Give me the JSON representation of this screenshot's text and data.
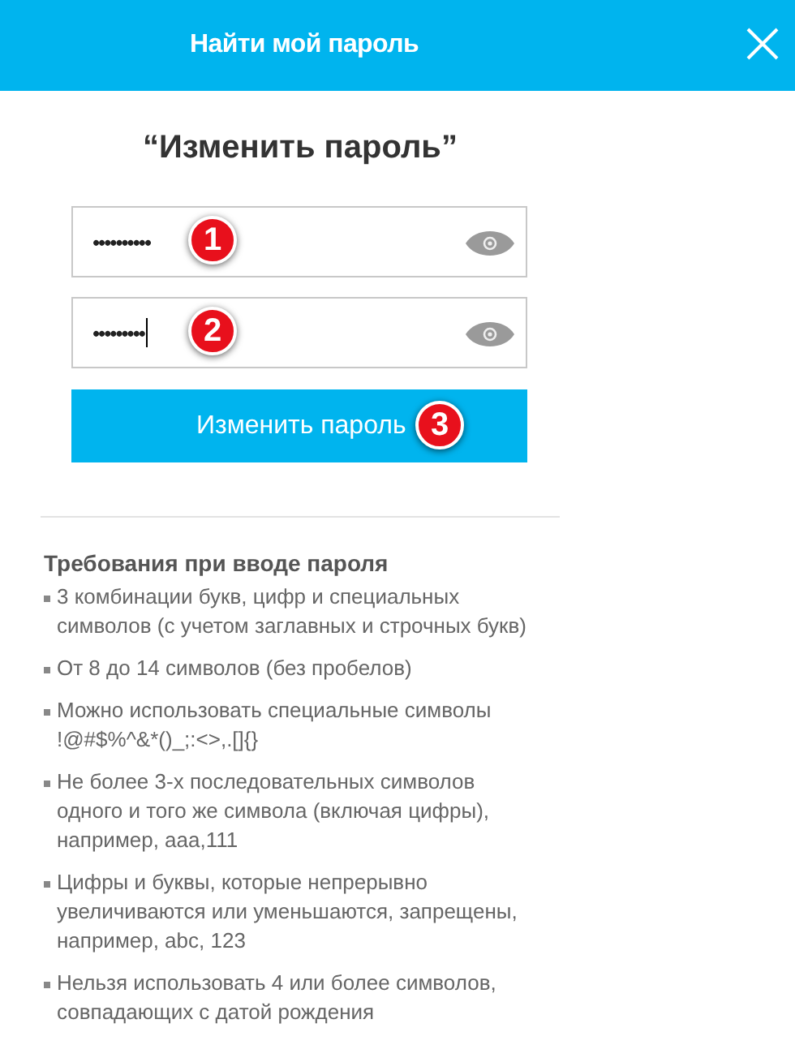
{
  "header": {
    "title": "Найти мой пароль"
  },
  "heading": "“Изменить пароль”",
  "fields": [
    {
      "value": "••••••••••",
      "focused": false,
      "callout": "1"
    },
    {
      "value": "•••••••••",
      "focused": true,
      "callout": "2"
    }
  ],
  "submit": {
    "label": "Изменить пароль",
    "callout": "3"
  },
  "requirements": {
    "title": "Требования при вводе пароля",
    "items": [
      "3 комбинации букв, цифр и специальных символов (с учетом заглавных и строчных букв)",
      "От 8 до 14 символов (без пробелов)",
      "Можно использовать специальные символы !@#$%^&*()_;:<>,.[]{}",
      "Не более 3-х последовательных символов одного и того же символа (включая цифры), например, aaa,111",
      "Цифры и буквы, которые непрерывно увеличиваются или уменьшаются, запрещены, например, abc, 123",
      "Нельзя использовать 4 или более символов, совпадающих с датой рождения"
    ]
  }
}
